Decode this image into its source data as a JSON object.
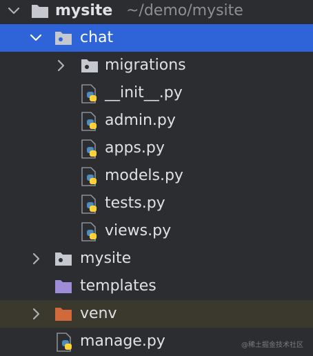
{
  "tree": {
    "root": {
      "label": "mysite",
      "path": "~/demo/mysite",
      "icon": "folder-icon",
      "expanded": true
    },
    "chat": {
      "label": "chat",
      "icon": "package-folder-icon",
      "expanded": true,
      "selected": true
    },
    "chat_children": [
      {
        "label": "migrations",
        "icon": "package-folder-icon",
        "expandable": true
      },
      {
        "label": "__init__.py",
        "icon": "python-file-icon"
      },
      {
        "label": "admin.py",
        "icon": "python-file-icon"
      },
      {
        "label": "apps.py",
        "icon": "python-file-icon"
      },
      {
        "label": "models.py",
        "icon": "python-file-icon"
      },
      {
        "label": "tests.py",
        "icon": "python-file-icon"
      },
      {
        "label": "views.py",
        "icon": "python-file-icon"
      }
    ],
    "mysite_pkg": {
      "label": "mysite",
      "icon": "package-folder-icon",
      "expandable": true
    },
    "templates": {
      "label": "templates",
      "icon": "templates-folder-icon"
    },
    "venv": {
      "label": "venv",
      "icon": "excluded-folder-icon",
      "expandable": true
    },
    "manage": {
      "label": "manage.py",
      "icon": "python-file-icon"
    }
  },
  "colors": {
    "background": "#2b2d30",
    "selection": "#2e64d8",
    "excluded_row": "#3b382d",
    "folder": "#c5c8cf",
    "templates_folder": "#9e8cd9",
    "excluded_folder": "#d06a3b",
    "python_blue": "#4b8bbe",
    "python_yellow": "#ffd43b"
  },
  "watermark": "@稀土掘金技术社区"
}
